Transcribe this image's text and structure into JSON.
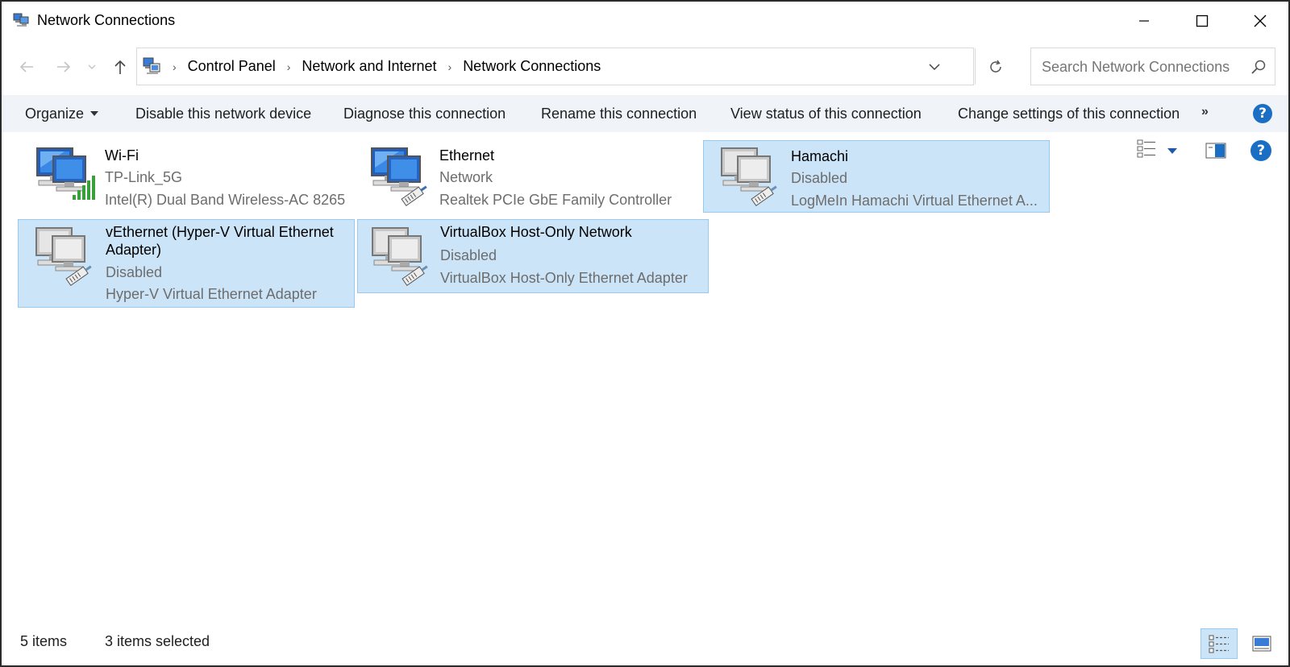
{
  "window": {
    "title": "Network Connections"
  },
  "address": {
    "crumbs": [
      "Control Panel",
      "Network and Internet",
      "Network Connections"
    ],
    "search_placeholder": "Search Network Connections"
  },
  "commands": {
    "organize": "Organize",
    "disable": "Disable this network device",
    "diagnose": "Diagnose this connection",
    "rename": "Rename this connection",
    "view_status": "View status of this connection",
    "change_settings": "Change settings of this connection",
    "more": "»"
  },
  "items": [
    {
      "name": "Wi-Fi",
      "status": "TP-Link_5G",
      "device": "Intel(R) Dual Band Wireless-AC 8265",
      "selected": false,
      "icon": "wifi-adapter-icon"
    },
    {
      "name": "Ethernet",
      "status": "Network",
      "device": "Realtek PCIe GbE Family Controller",
      "selected": false,
      "icon": "ethernet-adapter-icon"
    },
    {
      "name": "Hamachi",
      "status": "Disabled",
      "device": "LogMeIn Hamachi Virtual Ethernet A...",
      "selected": true,
      "icon": "disabled-adapter-icon"
    },
    {
      "name": "vEthernet (Hyper-V Virtual Ethernet Adapter)",
      "status": "Disabled",
      "device": "Hyper-V Virtual Ethernet Adapter",
      "selected": true,
      "icon": "disabled-adapter-icon"
    },
    {
      "name": "VirtualBox Host-Only Network",
      "status": "Disabled",
      "device": "VirtualBox Host-Only Ethernet Adapter",
      "selected": true,
      "icon": "disabled-adapter-icon"
    }
  ],
  "status": {
    "count": "5 items",
    "selected": "3 items selected"
  },
  "colors": {
    "selection_fill": "#cce4f7",
    "selection_border": "#99c9ef",
    "command_bar": "#f0f4f9",
    "help_blue": "#1a6fc4"
  }
}
